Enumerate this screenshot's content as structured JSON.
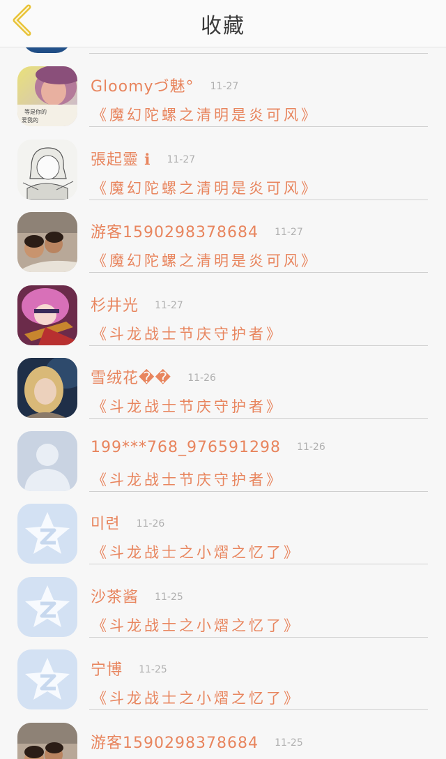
{
  "header": {
    "title": "收藏",
    "back_icon": "chevron-left-icon",
    "accent_color": "#e8c236"
  },
  "list": {
    "items": [
      {
        "name": "Gloomyづ魅°",
        "date": "11-27",
        "title": "《魔幻陀螺之清明是炎可风》",
        "avatar": "photo-girl-pink"
      },
      {
        "name": "張起靈 ℹ",
        "date": "11-27",
        "title": "《魔幻陀螺之清明是炎可风》",
        "avatar": "sketch-anime"
      },
      {
        "name": "游客1590298378684",
        "date": "11-27",
        "title": "《魔幻陀螺之清明是炎可风》",
        "avatar": "photo-kids"
      },
      {
        "name": "杉井光",
        "date": "11-27",
        "title": "《斗龙战士节庆守护者》",
        "avatar": "anime-pink-hair"
      },
      {
        "name": "雪绒花��",
        "date": "11-26",
        "title": "《斗龙战士节庆守护者》",
        "avatar": "photo-blonde-girl"
      },
      {
        "name": "199***768_976591298",
        "date": "11-26",
        "title": "《斗龙战士节庆守护者》",
        "avatar": "default-person"
      },
      {
        "name": "미련",
        "date": "11-26",
        "title": "《斗龙战士之小熠之忆了》",
        "avatar": "qzone-star"
      },
      {
        "name": "沙茶酱",
        "date": "11-25",
        "title": "《斗龙战士之小熠之忆了》",
        "avatar": "qzone-star"
      },
      {
        "name": "宁博",
        "date": "11-25",
        "title": "《斗龙战士之小熠之忆了》",
        "avatar": "qzone-star"
      },
      {
        "name": "游客1590298378684",
        "date": "11-25",
        "title": "",
        "avatar": "photo-kids"
      }
    ]
  }
}
